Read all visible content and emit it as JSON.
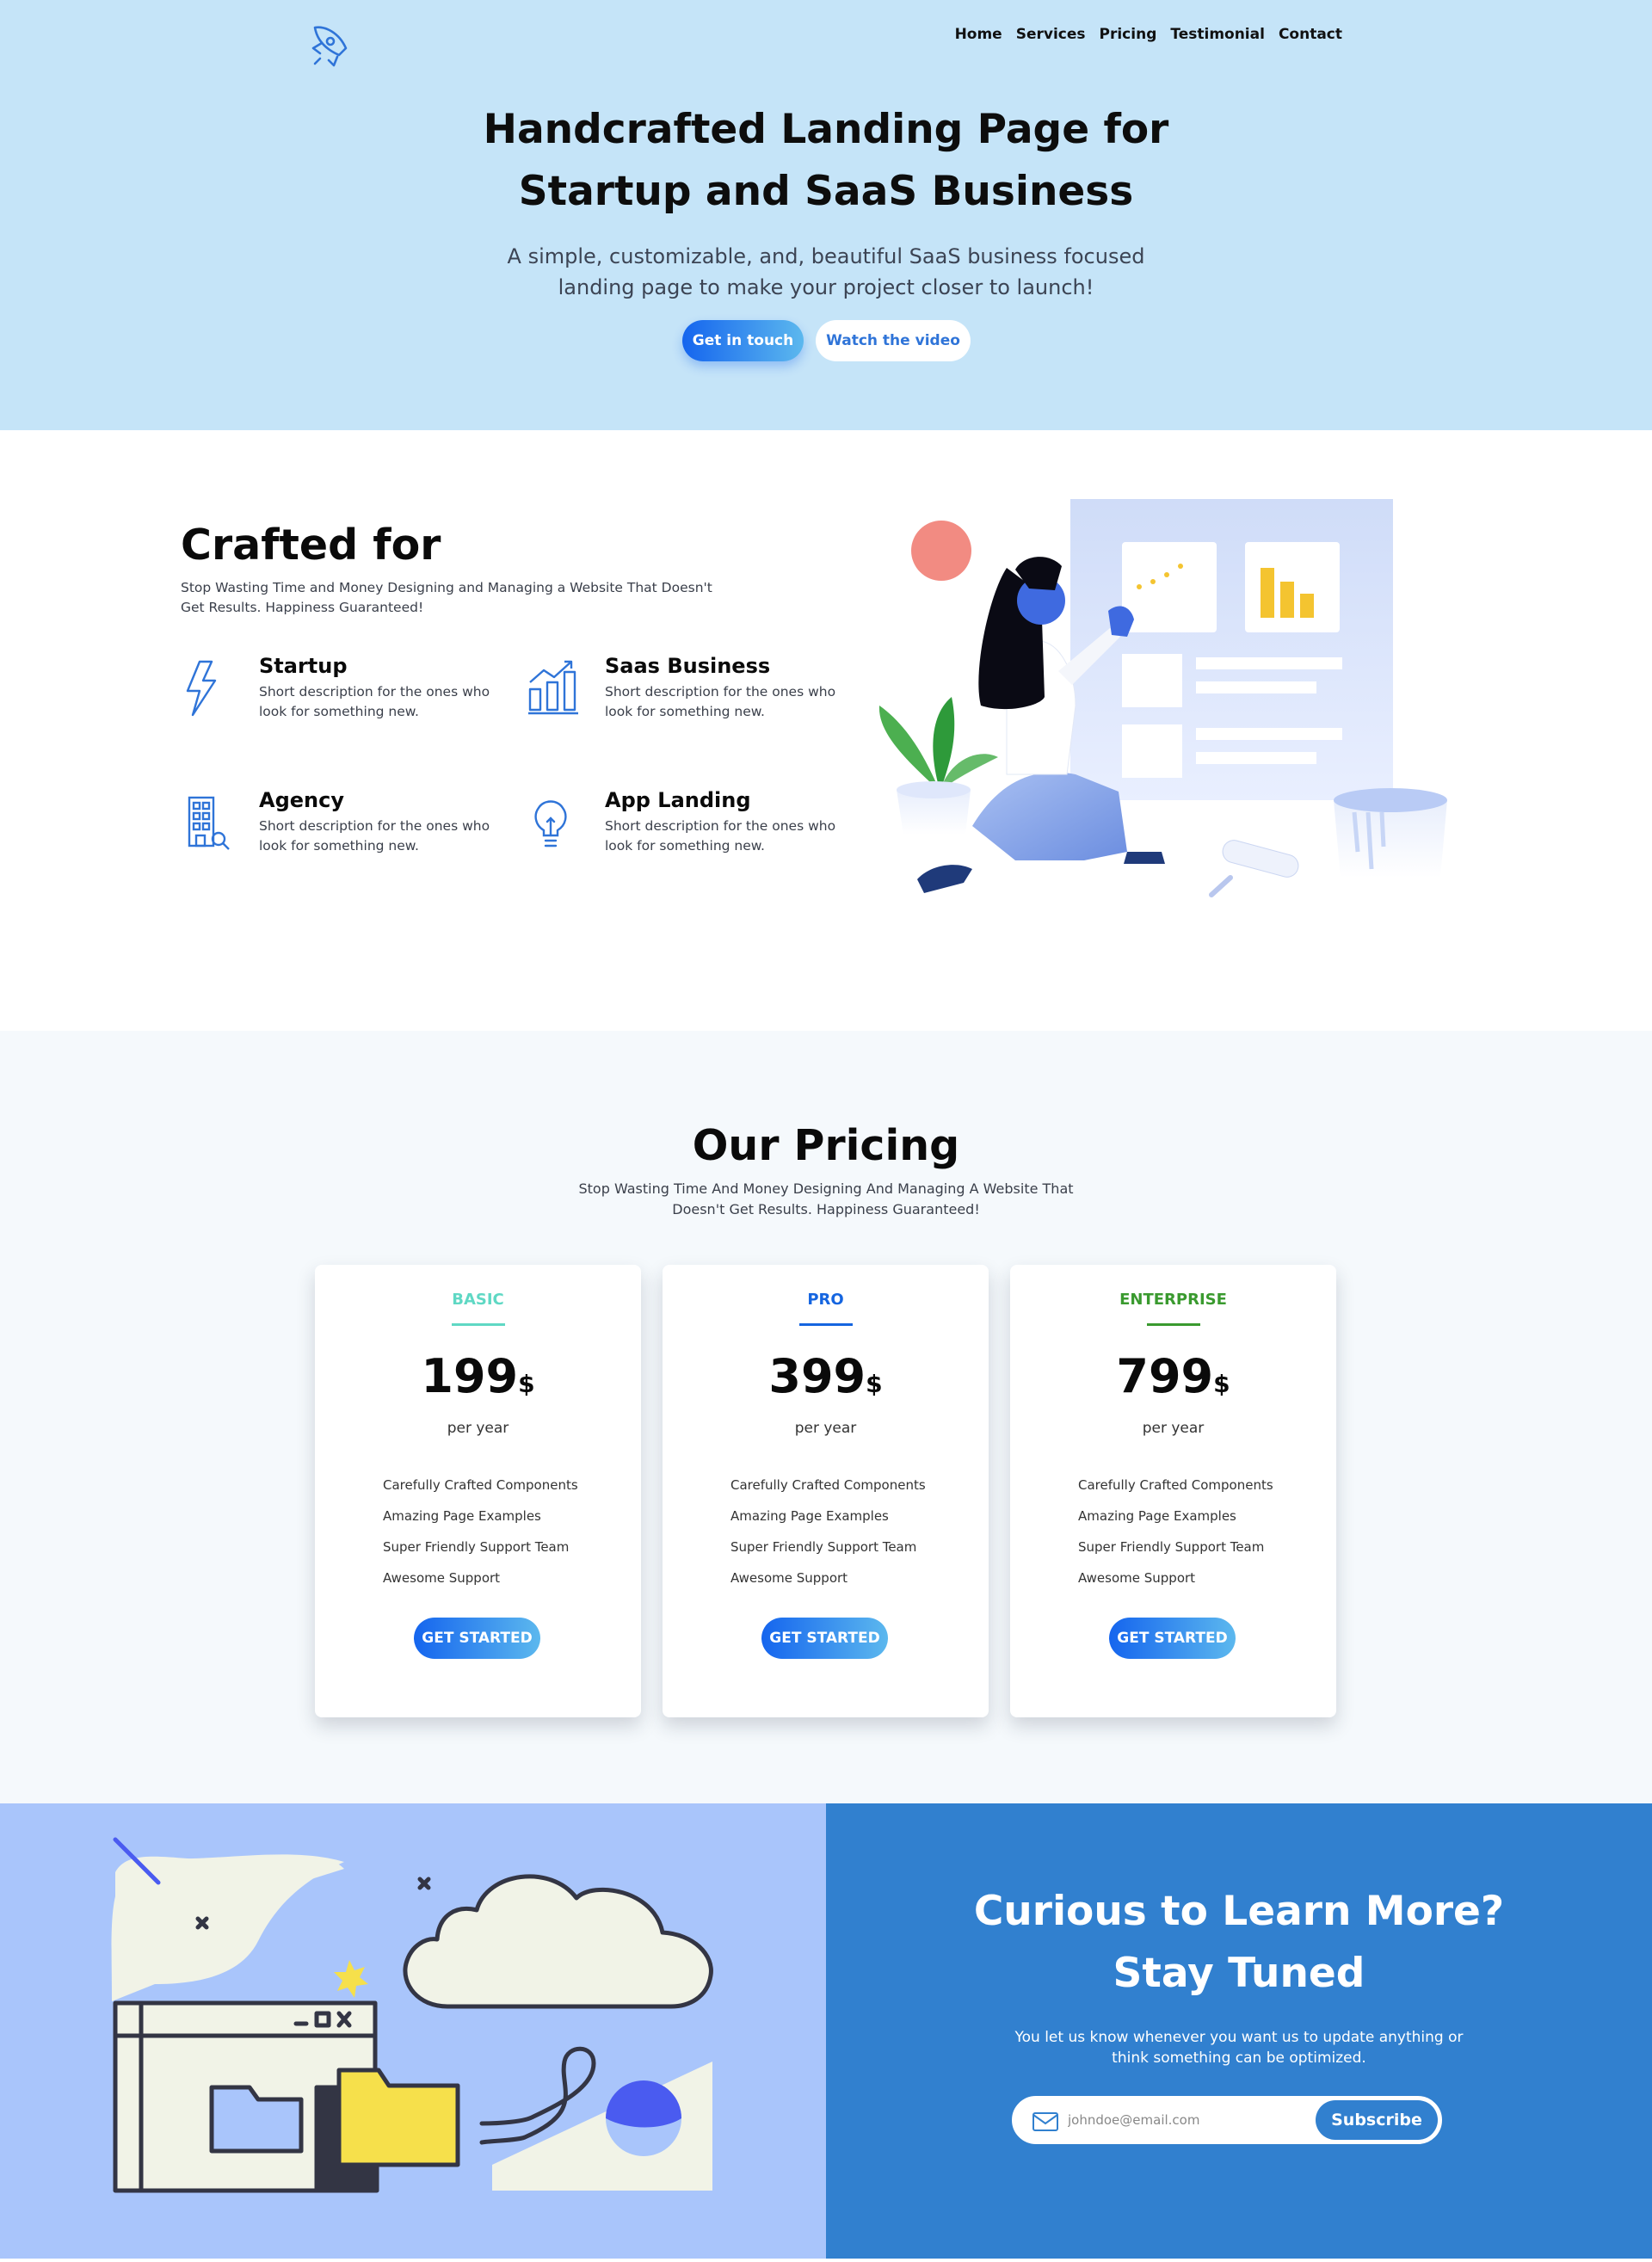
{
  "nav": {
    "items": [
      "Home",
      "Services",
      "Pricing",
      "Testimonial",
      "Contact"
    ]
  },
  "hero": {
    "title_line1": "Handcrafted Landing Page for",
    "title_line2": "Startup and SaaS Business",
    "subtitle": "A simple, customizable, and, beautiful SaaS business focused landing page to make your project closer to launch!",
    "primary_button": "Get in touch",
    "secondary_button": "Watch the video"
  },
  "crafted": {
    "title": "Crafted for",
    "description": "Stop Wasting Time and Money Designing and Managing a Website That Doesn't Get Results. Happiness Guaranteed!",
    "features": [
      {
        "title": "Startup",
        "desc": "Short description for the ones who look for something new.",
        "icon": "lightning-icon"
      },
      {
        "title": "Saas Business",
        "desc": "Short description for the ones who look for something new.",
        "icon": "chart-icon"
      },
      {
        "title": "Agency",
        "desc": "Short description for the ones who look for something new.",
        "icon": "building-icon"
      },
      {
        "title": "App Landing",
        "desc": "Short description for the ones who look for something new.",
        "icon": "lightbulb-icon"
      }
    ]
  },
  "pricing": {
    "title": "Our Pricing",
    "description": "Stop Wasting Time And Money Designing And Managing A Website That Doesn't Get Results. Happiness Guaranteed!",
    "plans": [
      {
        "name": "BASIC",
        "price": "199",
        "currency": "$",
        "period": "per year",
        "color": "#5fd8c4",
        "features": [
          "Carefully Crafted Components",
          "Amazing Page Examples",
          "Super Friendly Support Team",
          "Awesome Support"
        ],
        "cta": "GET STARTED"
      },
      {
        "name": "PRO",
        "price": "399",
        "currency": "$",
        "period": "per year",
        "color": "#1565e0",
        "features": [
          "Carefully Crafted Components",
          "Amazing Page Examples",
          "Super Friendly Support Team",
          "Awesome Support"
        ],
        "cta": "GET STARTED"
      },
      {
        "name": "ENTERPRISE",
        "price": "799",
        "currency": "$",
        "period": "per year",
        "color": "#3a9a2f",
        "features": [
          "Carefully Crafted Components",
          "Amazing Page Examples",
          "Super Friendly Support Team",
          "Awesome Support"
        ],
        "cta": "GET STARTED"
      }
    ]
  },
  "newsletter": {
    "title_line1": "Curious to Learn More?",
    "title_line2": "Stay Tuned",
    "description": "You let us know whenever you want us to update anything or think something can be optimized.",
    "email_placeholder": "johndoe@email.com",
    "subscribe_button": "Subscribe"
  },
  "colors": {
    "hero_bg": "#c5e4f8",
    "accent": "#1565ee",
    "newsletter_bg": "#3180cf",
    "newsletter_left_bg": "#a9c5fb"
  }
}
